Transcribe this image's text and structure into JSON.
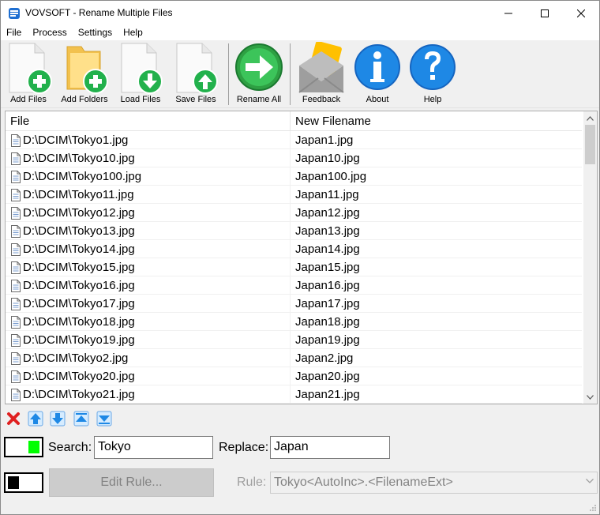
{
  "window": {
    "title": "VOVSOFT - Rename Multiple Files"
  },
  "menu": [
    "File",
    "Process",
    "Settings",
    "Help"
  ],
  "toolbar": {
    "add_files": "Add Files",
    "add_folders": "Add Folders",
    "load_files": "Load Files",
    "save_files": "Save Files",
    "rename_all": "Rename All",
    "feedback": "Feedback",
    "about": "About",
    "help": "Help"
  },
  "list": {
    "columns": [
      "File",
      "New Filename"
    ],
    "rows": [
      [
        "D:\\DCIM\\Tokyo1.jpg",
        "Japan1.jpg"
      ],
      [
        "D:\\DCIM\\Tokyo10.jpg",
        "Japan10.jpg"
      ],
      [
        "D:\\DCIM\\Tokyo100.jpg",
        "Japan100.jpg"
      ],
      [
        "D:\\DCIM\\Tokyo11.jpg",
        "Japan11.jpg"
      ],
      [
        "D:\\DCIM\\Tokyo12.jpg",
        "Japan12.jpg"
      ],
      [
        "D:\\DCIM\\Tokyo13.jpg",
        "Japan13.jpg"
      ],
      [
        "D:\\DCIM\\Tokyo14.jpg",
        "Japan14.jpg"
      ],
      [
        "D:\\DCIM\\Tokyo15.jpg",
        "Japan15.jpg"
      ],
      [
        "D:\\DCIM\\Tokyo16.jpg",
        "Japan16.jpg"
      ],
      [
        "D:\\DCIM\\Tokyo17.jpg",
        "Japan17.jpg"
      ],
      [
        "D:\\DCIM\\Tokyo18.jpg",
        "Japan18.jpg"
      ],
      [
        "D:\\DCIM\\Tokyo19.jpg",
        "Japan19.jpg"
      ],
      [
        "D:\\DCIM\\Tokyo2.jpg",
        "Japan2.jpg"
      ],
      [
        "D:\\DCIM\\Tokyo20.jpg",
        "Japan20.jpg"
      ],
      [
        "D:\\DCIM\\Tokyo21.jpg",
        "Japan21.jpg"
      ]
    ]
  },
  "search": {
    "label": "Search:",
    "value": "Tokyo",
    "replace_label": "Replace:",
    "replace_value": "Japan"
  },
  "rule": {
    "edit_button": "Edit Rule...",
    "label": "Rule:",
    "value": "Tokyo<AutoInc>.<FilenameExt>"
  },
  "colors": {
    "accent_blue": "#1e88e5",
    "add_green": "#22b14c",
    "toggle_green": "#00ff00"
  }
}
